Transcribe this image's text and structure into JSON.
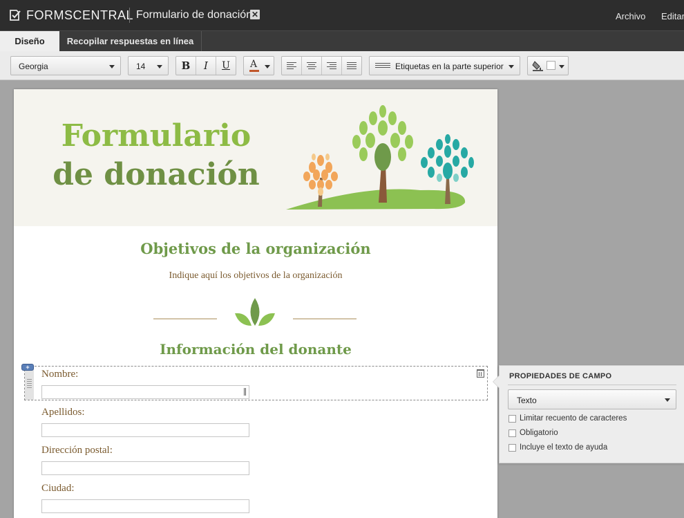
{
  "app": {
    "brand": "FORMSCENTRAL",
    "document_title": "Formulario de donación",
    "menu": [
      "Archivo",
      "Editar"
    ]
  },
  "tabs": [
    {
      "label": "Diseño",
      "active": true
    },
    {
      "label": "Recopilar respuestas en línea",
      "active": false
    }
  ],
  "toolbar": {
    "font_family": "Georgia",
    "font_size": "14",
    "bold": "B",
    "italic": "I",
    "underline": "U",
    "text_color_glyph": "A",
    "text_color": "#c0572b",
    "label_position": "Etiquetas en la parte superior"
  },
  "form": {
    "title_line1": "Formulario",
    "title_line2": "de donación",
    "section1_title": "Objetivos de la organización",
    "section1_subtitle": "Indique aquí los objetivos de la organización",
    "section2_title": "Información del donante",
    "fields": [
      {
        "label": "Nombre:"
      },
      {
        "label": "Apellidos:"
      },
      {
        "label": "Dirección postal:"
      },
      {
        "label": "Ciudad:"
      }
    ]
  },
  "field_properties": {
    "title": "PROPIEDADES DE CAMPO",
    "field_type": "Texto",
    "options": [
      {
        "label": "Limitar recuento de caracteres",
        "checked": false
      },
      {
        "label": "Obligatorio",
        "checked": false
      },
      {
        "label": "Incluye el texto de ayuda",
        "checked": false
      }
    ]
  },
  "colors": {
    "title_light_green": "#8dbb45",
    "title_dark_green": "#6f9044",
    "section_green": "#6f9a4a",
    "label_brown": "#7a5a2e"
  }
}
